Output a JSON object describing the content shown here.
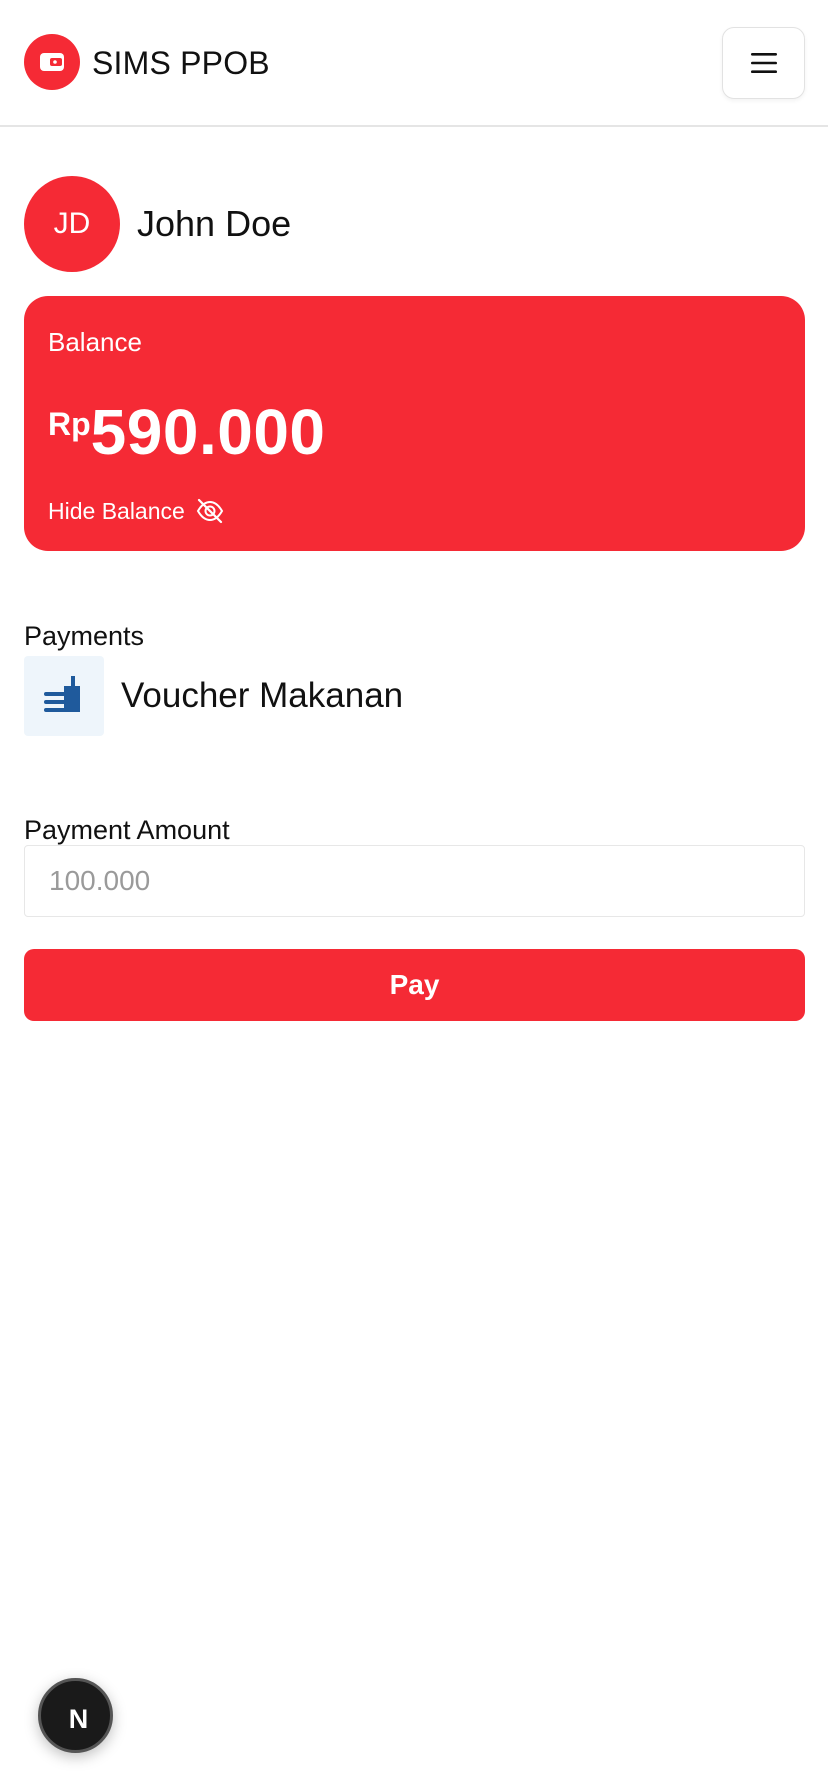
{
  "header": {
    "brand": "SIMS PPOB",
    "logo_icon": "wallet-icon",
    "menu_icon": "hamburger-menu-icon"
  },
  "profile": {
    "initials": "JD",
    "name": "John Doe"
  },
  "balance": {
    "label": "Balance",
    "currency": "Rp",
    "amount": "590.000",
    "toggle_label": "Hide Balance",
    "toggle_icon": "eye-off-icon"
  },
  "payment": {
    "section_label": "Payments",
    "service_name": "Voucher Makanan",
    "service_icon": "food-voucher-icon",
    "amount_label": "Payment Amount",
    "amount_placeholder": "100.000",
    "pay_label": "Pay"
  },
  "dev_badge": {
    "letter": "N",
    "icon": "nextjs-icon"
  },
  "colors": {
    "accent": "#f52a35",
    "service_icon_bg": "#eef5fb",
    "service_icon_fg": "#1f5a9c"
  }
}
